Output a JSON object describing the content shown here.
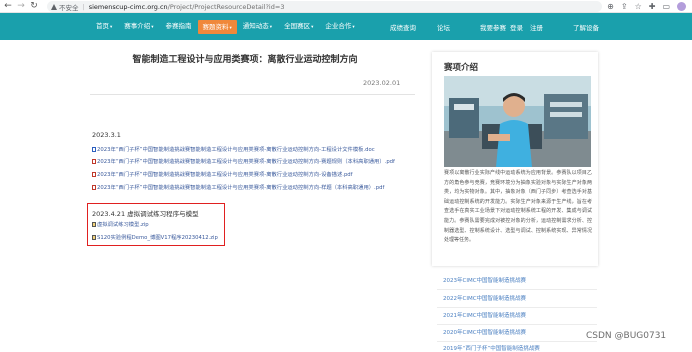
{
  "browser": {
    "back_icon": "arrow-left-icon",
    "forward_icon": "arrow-right-icon",
    "reload_icon": "reload-icon",
    "security_label": "不安全",
    "url_host": "siemenscup-cimc.org.cn",
    "url_path": "/Project/ProjectResourceDetail?id=3",
    "right_icons": [
      "zoom-icon",
      "share-icon",
      "bookmark-star-icon",
      "extensions-icon",
      "reading-list-icon",
      "profile-icon"
    ]
  },
  "site_nav": {
    "items": [
      {
        "label": "首页",
        "dropdown": true
      },
      {
        "label": "赛事介绍",
        "dropdown": true
      },
      {
        "label": "参赛指南",
        "dropdown": false
      },
      {
        "label": "赛题资料",
        "dropdown": true,
        "active": true
      },
      {
        "label": "通知动态",
        "dropdown": true
      },
      {
        "label": "全国赛区",
        "dropdown": true
      },
      {
        "label": "企业合作",
        "dropdown": true
      }
    ],
    "right": {
      "results": "成绩查询",
      "forum": "论坛",
      "signup": "我要参赛",
      "login": "登录",
      "register": "注册",
      "devices": "了解设备"
    },
    "colors": {
      "bar": "#1aa0ac",
      "active": "#f0883a"
    }
  },
  "article": {
    "title": "智能制造工程设计与应用类赛项：离散行业运动控制方向",
    "date": "2023.02.01",
    "sections": [
      {
        "label": "2023.3.1",
        "files": [
          {
            "type": "doc",
            "name": "2023年“西门子杯”中国智能制造挑战赛智能制造工程设计与应用类赛项-离散行业运动控制方向-工程设计文件模板.doc"
          },
          {
            "type": "pdf",
            "name": "2023年“西门子杯”中国智能制造挑战赛智能制造工程设计与应用类赛项-离散行业运动控制方向-赛题规则（本科高职通用）.pdf"
          },
          {
            "type": "pdf",
            "name": "2023年“西门子杯”中国智能制造挑战赛智能制造工程设计与应用类赛项-离散行业运动控制方向-设备描述.pdf"
          },
          {
            "type": "pdf",
            "name": "2023年“西门子杯”中国智能制造挑战赛智能制造工程设计与应用类赛项-离散行业运动控制方向-样题（本科高职通用）.pdf"
          }
        ]
      },
      {
        "label": "2023.4.21 虚拟调试练习程序与模型",
        "files": [
          {
            "type": "zip",
            "name": "虚拟调试练习模型.zip"
          },
          {
            "type": "zip",
            "name": "S120实验例程Demo_博图V17程序20230412.zip"
          }
        ]
      }
    ]
  },
  "sidebar": {
    "title": "赛项介绍",
    "description": "赛项以离散行业实际产线中运动系统为应用背景。参赛队以项目乙方的角色参与竞赛，竞赛环境分为抽象实验对象与实际生产对象两类，均为实物对象。其中，抽象对象（西门子同步）考查选手对基础运动控制系统的开发能力。实际生产对象来源于生产线，旨在考查选手在真实工业场景下对运动控制系统工程的开发、集成与调试能力。参赛队需要完成对被控对象的分析，运动控制需求分析、控制器选型、控制系统设计、选型与调试、控制系统实现、异常情况处理等任务。",
    "photo_alt": "student-with-equipment-photo",
    "links": [
      "2023年CIMC中国智能制造挑战赛",
      "2022年CIMC中国智能制造挑战赛",
      "2021年CIMC中国智能制造挑战赛",
      "2020年CIMC中国智能制造挑战赛",
      "2019年“西门子杯”中国智能制造挑战赛"
    ]
  },
  "watermark": "CSDN @BUG0731"
}
